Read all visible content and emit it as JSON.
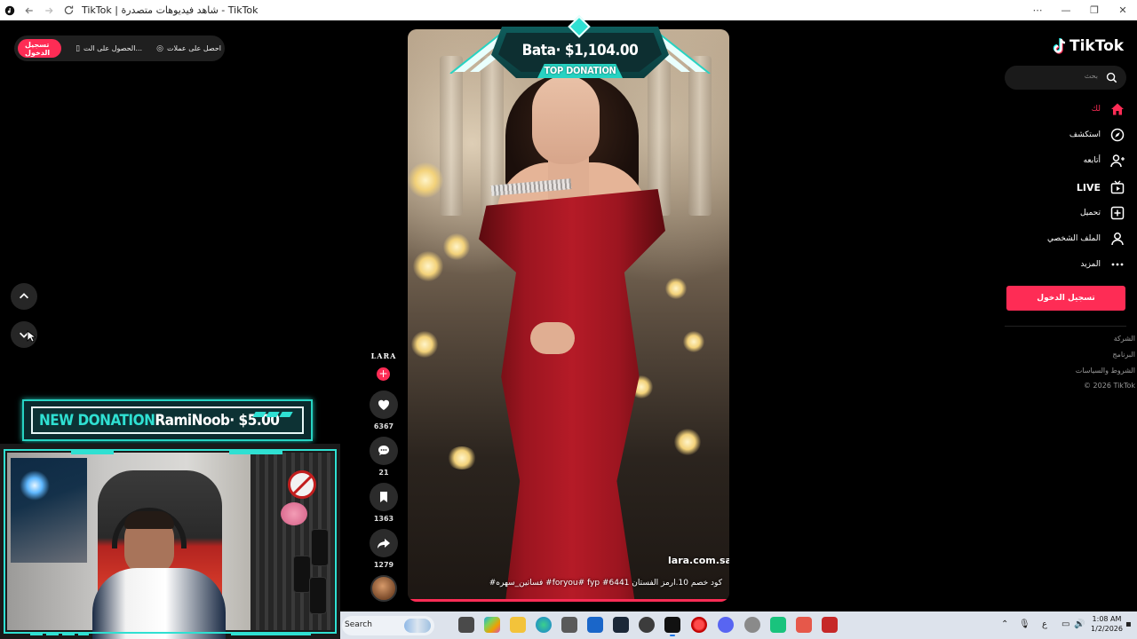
{
  "browser": {
    "title": "TikTok | شاهد فيديوهات متصدرة - TikTok",
    "controls": [
      "more-icon",
      "minimize-icon",
      "restore-icon",
      "close-icon"
    ]
  },
  "topbar": {
    "login": "تسجيل الدخول",
    "get_app": "الحصول على الت...",
    "get_coins": "احصل على عملات"
  },
  "overlay": {
    "donation_label": "NEW DONATION",
    "donation_text": "RamiNoob· $5.00",
    "top_donation_amount": "Bata· $1,104.00",
    "top_donation_label": "TOP DONATION"
  },
  "video": {
    "handle": "lara.com.sa",
    "caption": "كود خصم 10.ارمز الفستان 6441# foryou# fyp# فساتين_سهره#",
    "progress_fraction": 1.0
  },
  "actions": {
    "author": "LARA",
    "likes": "6367",
    "comments": "21",
    "saves": "1363",
    "shares": "1279"
  },
  "sidebar": {
    "brand": "TikTok",
    "search_placeholder": "بحث",
    "items": [
      {
        "label": "لك",
        "icon": "home-icon",
        "active": true
      },
      {
        "label": "استكشف",
        "icon": "compass-icon"
      },
      {
        "label": "أتابعه",
        "icon": "following-icon"
      },
      {
        "label": "LIVE",
        "icon": "live-icon"
      },
      {
        "label": "تحميل",
        "icon": "upload-icon"
      },
      {
        "label": "الملف الشخصي",
        "icon": "profile-icon"
      },
      {
        "label": "المزيد",
        "icon": "more-icon"
      }
    ],
    "login_button": "تسجيل الدخول",
    "footer": [
      "الشركة",
      "البرنامج",
      "الشروط والسياسات",
      "© 2026 TikTok"
    ]
  },
  "taskbar": {
    "search_label": "Search",
    "lang": "ع",
    "time": "1:08 AM",
    "date": "1/2/2026"
  },
  "colors": {
    "accent": "#fe2c55",
    "hud_cyan": "#2fe0d2",
    "background": "#000000"
  }
}
